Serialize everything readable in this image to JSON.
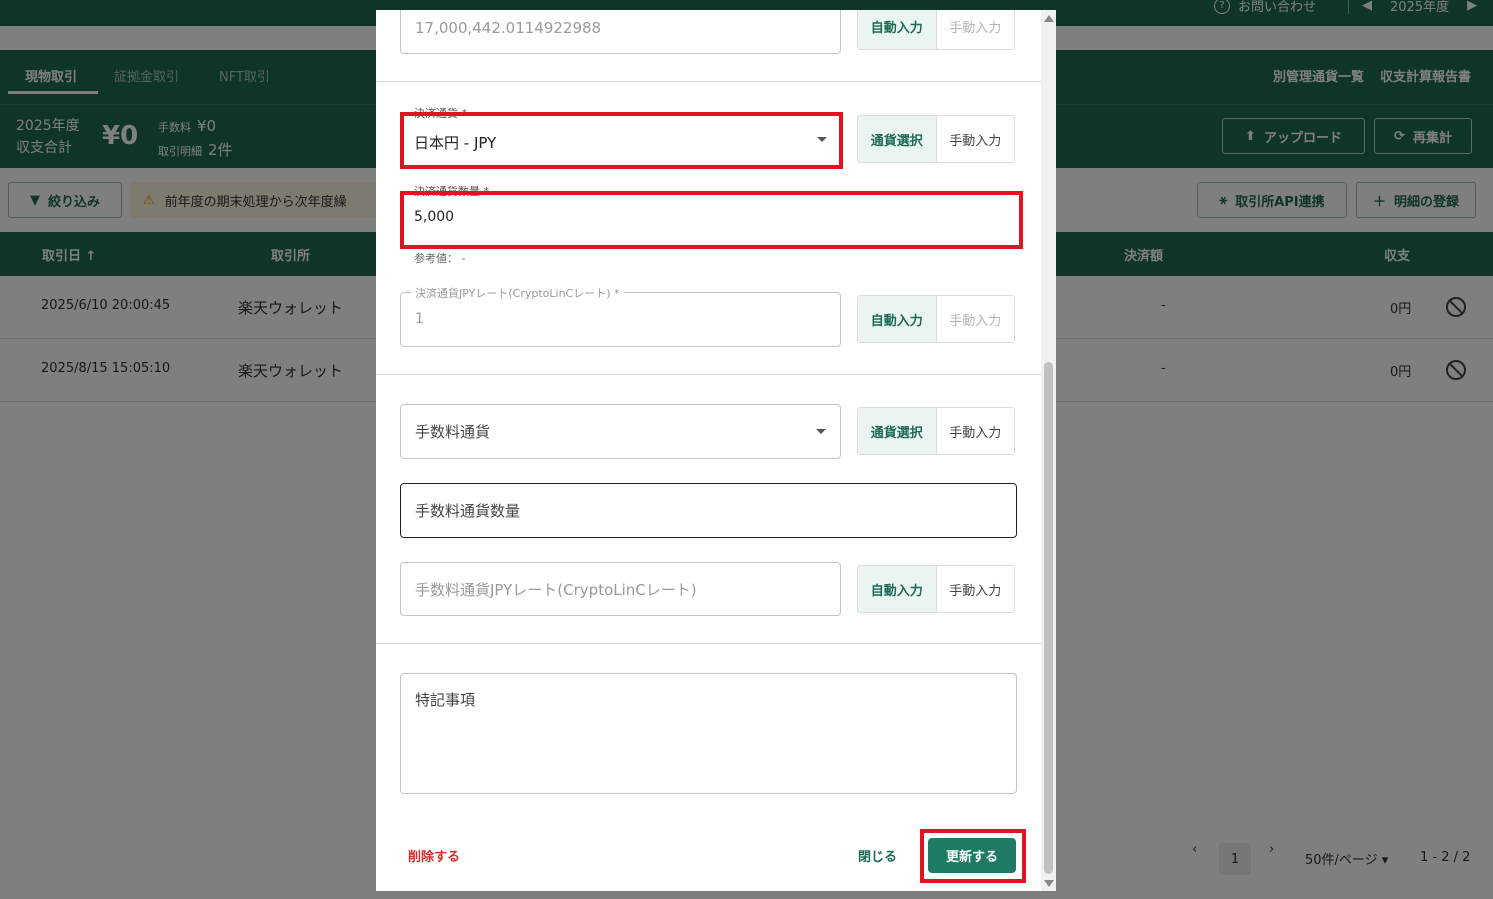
{
  "topbar": {
    "help": "お問い合わせ",
    "year": "2025年度"
  },
  "tabs": {
    "spot": "現物取引",
    "margin": "証拠金取引",
    "nft": "NFT取引",
    "separate_currency": "別管理通貨一覧",
    "report": "収支計算報告書"
  },
  "summary": {
    "year": "2025年度",
    "total_label": "収支合計",
    "total": "¥0",
    "fee_label": "手数料",
    "fee": "¥0",
    "detail_label": "取引明細",
    "detail": "2件",
    "upload": "アップロード",
    "recalc": "再集計"
  },
  "filterrow": {
    "filter": "絞り込み",
    "warning": "前年度の期末処理から次年度繰",
    "api": "取引所API連携",
    "add": "明細の登録"
  },
  "table": {
    "headers": {
      "date": "取引日 ↑",
      "exchange": "取引所",
      "settlement": "決済額",
      "income": "収支"
    },
    "rows": [
      {
        "date": "2025/6/10 20:00:45",
        "exchange": "楽天ウォレット",
        "settlement": "-",
        "income": "0円"
      },
      {
        "date": "2025/8/15 15:05:10",
        "exchange": "楽天ウォレット",
        "settlement": "-",
        "income": "0円"
      }
    ]
  },
  "pager": {
    "page": "1",
    "per_page": "50件/ページ",
    "range": "1 - 2 / 2"
  },
  "modal": {
    "top_amount": {
      "value": "17,000,442.0114922988",
      "auto": "自動入力",
      "manual": "手動入力"
    },
    "settle_currency": {
      "label": "決済通貨 *",
      "value": "日本円 - JPY",
      "select": "通貨選択",
      "manual": "手動入力"
    },
    "settle_amount": {
      "label": "決済通貨数量 *",
      "value": "5,000",
      "hint": "参考値： -"
    },
    "settle_rate": {
      "label": "決済通貨JPYレート(CryptoLinCレート) *",
      "value": "1",
      "auto": "自動入力",
      "manual": "手動入力"
    },
    "fee_currency": {
      "placeholder": "手数料通貨",
      "select": "通貨選択",
      "manual": "手動入力"
    },
    "fee_amount": {
      "placeholder": "手数料通貨数量"
    },
    "fee_rate": {
      "placeholder": "手数料通貨JPYレート(CryptoLinCレート)",
      "auto": "自動入力",
      "manual": "手動入力"
    },
    "notes": {
      "placeholder": "特記事項"
    },
    "footer": {
      "delete": "削除する",
      "close": "閉じる",
      "update": "更新する"
    }
  },
  "colors": {
    "primary": "#1e6a56",
    "danger": "#d32f2f",
    "highlight": "#e0141e"
  }
}
